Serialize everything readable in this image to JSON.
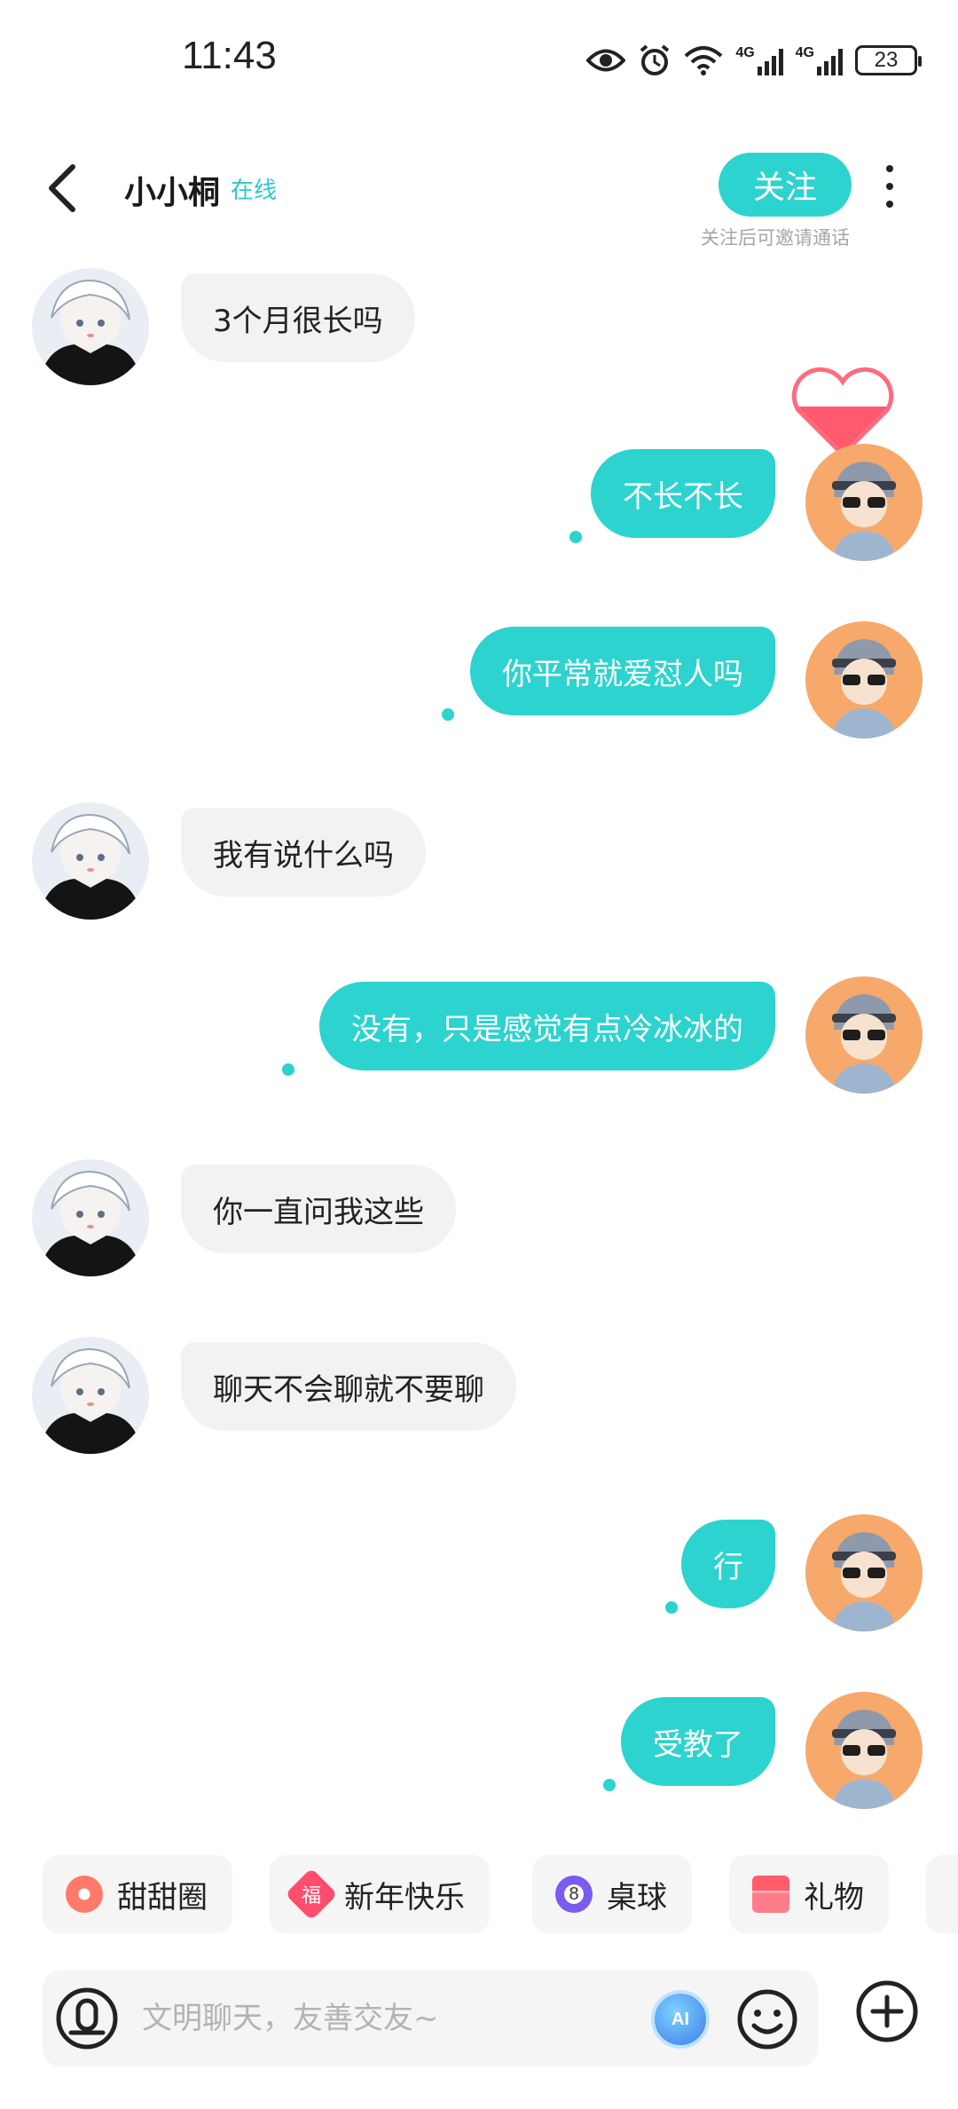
{
  "status_bar": {
    "time": "11:43",
    "battery": "23",
    "network_1": "4G",
    "network_2": "4G"
  },
  "header": {
    "back_icon": "chevron-left-icon",
    "name": "小小桐",
    "online": "在线",
    "follow_label": "关注",
    "follow_hint": "关注后可邀请通话",
    "more_icon": "more-vertical-icon"
  },
  "messages": [
    {
      "from": "other",
      "text": "3个月很长吗"
    },
    {
      "from": "me",
      "text": "不长不长"
    },
    {
      "from": "me",
      "text": "你平常就爱怼人吗"
    },
    {
      "from": "other",
      "text": "我有说什么吗"
    },
    {
      "from": "me",
      "text": "没有，只是感觉有点冷冰冰的"
    },
    {
      "from": "other",
      "text": "你一直问我这些"
    },
    {
      "from": "other",
      "text": "聊天不会聊就不要聊"
    },
    {
      "from": "me",
      "text": "行"
    },
    {
      "from": "me",
      "text": "受教了"
    }
  ],
  "quick_actions": [
    {
      "label": "甜甜圈",
      "icon": "donut-icon"
    },
    {
      "label": "新年快乐",
      "icon": "fortune-icon"
    },
    {
      "label": "桌球",
      "icon": "billiard-ball-icon"
    },
    {
      "label": "礼物",
      "icon": "gift-icon"
    }
  ],
  "billiard_number": "8",
  "fortune_char": "福",
  "input": {
    "placeholder": "文明聊天，友善交友~",
    "value": ""
  },
  "ai_label": "AI",
  "colors": {
    "accent": "#2dd3cf",
    "bubble_in": "#f2f2f2",
    "online": "#2cc8c8"
  }
}
